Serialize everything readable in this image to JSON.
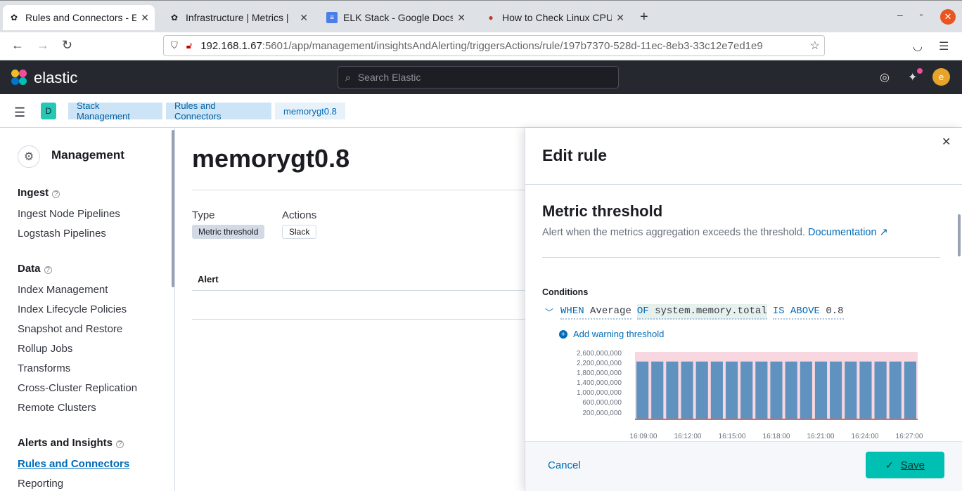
{
  "browser": {
    "tabs": [
      {
        "title": "Rules and Connectors - El",
        "active": true
      },
      {
        "title": "Infrastructure | Metrics | ",
        "active": false
      },
      {
        "title": "ELK Stack - Google Docs",
        "active": false
      },
      {
        "title": "How to Check Linux CPU",
        "active": false
      }
    ],
    "url_host": "192.168.1.67",
    "url_path": ":5601/app/management/insightsAndAlerting/triggersActions/rule/197b7370-528d-11ec-8eb3-33c12e7ed1e9"
  },
  "kibana": {
    "logo_text": "elastic",
    "search_placeholder": "Search Elastic",
    "avatar_letter": "e",
    "space_letter": "D",
    "breadcrumbs": [
      "Stack Management",
      "Rules and Connectors",
      "memorygt0.8"
    ]
  },
  "sidebar": {
    "title": "Management",
    "sections": [
      {
        "heading": "Ingest",
        "items": [
          "Ingest Node Pipelines",
          "Logstash Pipelines"
        ]
      },
      {
        "heading": "Data",
        "items": [
          "Index Management",
          "Index Lifecycle Policies",
          "Snapshot and Restore",
          "Rollup Jobs",
          "Transforms",
          "Cross-Cluster Replication",
          "Remote Clusters"
        ]
      },
      {
        "heading": "Alerts and Insights",
        "items": [
          "Rules and Connectors",
          "Reporting"
        ]
      }
    ],
    "selected_item": "Rules and Connectors"
  },
  "main": {
    "title": "memorygt0.8",
    "type_label": "Type",
    "type_value": "Metric threshold",
    "actions_label": "Actions",
    "actions_value": "Slack",
    "table_header": "Alert"
  },
  "flyout": {
    "title": "Edit rule",
    "rule_type_title": "Metric threshold",
    "rule_desc": "Alert when the metrics aggregation exceeds the threshold.",
    "doc_link": "Documentation",
    "conditions_label": "Conditions",
    "expr": {
      "when": "WHEN",
      "agg": "Average",
      "of": "OF",
      "field": "system.memory.total",
      "is_above": "IS ABOVE",
      "threshold": "0.8"
    },
    "add_warning": "Add warning threshold",
    "cancel_label": "Cancel",
    "save_label": "Save"
  },
  "chart_data": {
    "type": "bar",
    "title": "",
    "xlabel": "",
    "ylabel": "",
    "y_tick_labels": [
      "2,600,000,000",
      "2,200,000,000",
      "1,800,000,000",
      "1,400,000,000",
      "1,000,000,000",
      "600,000,000",
      "200,000,000"
    ],
    "x_tick_labels": [
      "16:09:00",
      "16:12:00",
      "16:15:00",
      "16:18:00",
      "16:21:00",
      "16:24:00",
      "16:27:00"
    ],
    "ylim": [
      0,
      2800000000
    ],
    "values": [
      2400000000,
      2400000000,
      2400000000,
      2400000000,
      2400000000,
      2400000000,
      2400000000,
      2400000000,
      2400000000,
      2400000000,
      2400000000,
      2400000000,
      2400000000,
      2400000000,
      2400000000,
      2400000000,
      2400000000,
      2400000000,
      2400000000
    ],
    "threshold": 0.8,
    "colors": {
      "bar": "#6092c0",
      "threshold_area": "#f5c6d3",
      "threshold_line": "#e7664c"
    }
  }
}
